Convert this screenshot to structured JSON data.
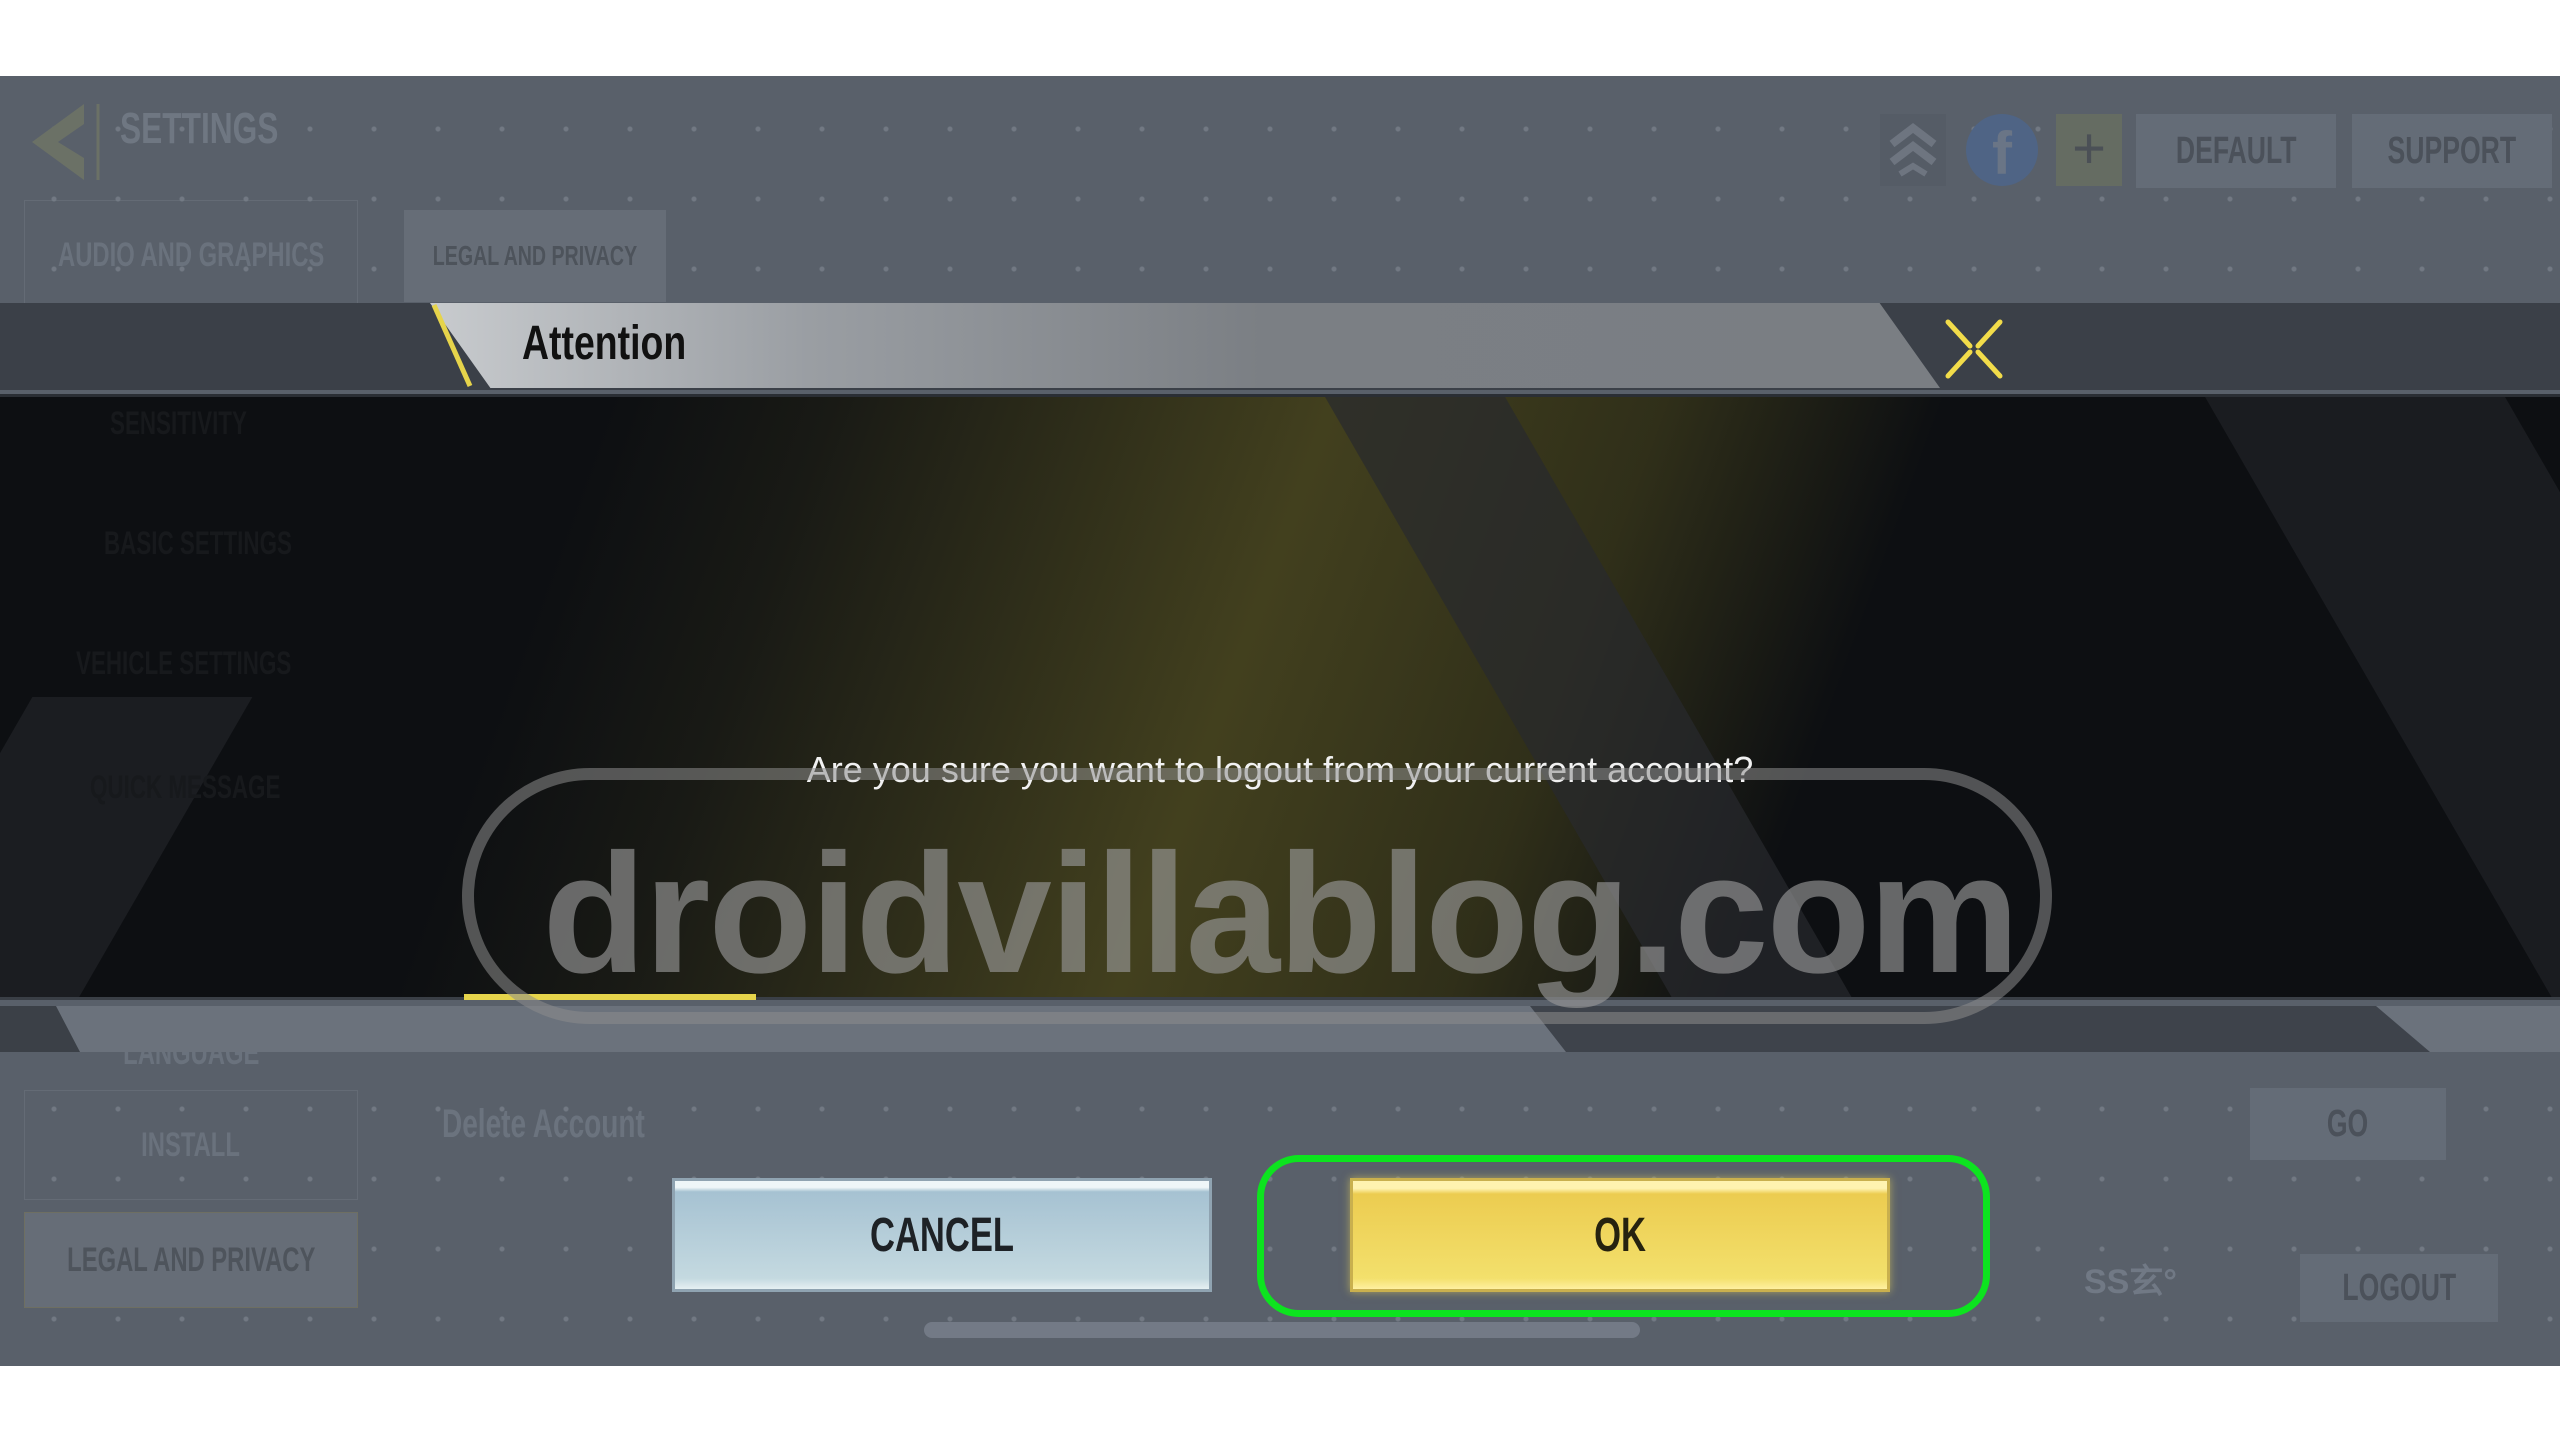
{
  "background": {
    "header": {
      "title": "SETTINGS",
      "icons": [
        "rank-chevrons-icon",
        "facebook-icon",
        "plus-icon"
      ],
      "buttons": {
        "default": "DEFAULT",
        "support": "SUPPORT"
      }
    },
    "sidebar": {
      "items": [
        {
          "label": "AUDIO AND GRAPHICS"
        },
        {
          "label": "SENSITIVITY"
        },
        {
          "label": "BASIC SETTINGS"
        },
        {
          "label": "VEHICLE SETTINGS"
        },
        {
          "label": "QUICK MESSAGE"
        },
        {
          "label": "LANGUAGE"
        },
        {
          "label": "INSTALL"
        },
        {
          "label": "LEGAL AND PRIVACY",
          "active": true
        }
      ]
    },
    "content": {
      "tab": "LEGAL AND PRIVACY",
      "delete_account_label": "Delete Account",
      "go_button": "GO",
      "account_id": "SS玄°",
      "logout_button": "LOGOUT"
    }
  },
  "dialog": {
    "title": "Attention",
    "message": "Are you sure you want to logout from your current account?",
    "cancel_label": "CANCEL",
    "ok_label": "OK",
    "close_icon": "close-x-icon"
  },
  "watermark": "droidvillablog.com",
  "colors": {
    "accent_yellow": "#e6d44b",
    "highlight_green": "#0de31f",
    "ok_yellow": "#f0d75c",
    "cancel_blue": "#b6cdd8",
    "bg_gray": "#59606a"
  }
}
